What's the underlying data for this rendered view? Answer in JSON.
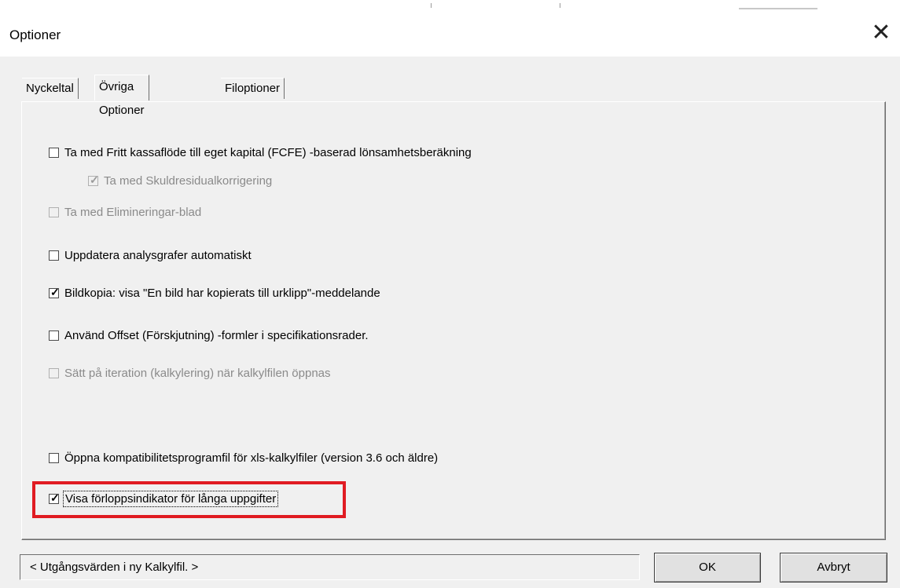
{
  "window": {
    "title": "Optioner",
    "close_icon": "close-icon"
  },
  "tabs": [
    {
      "label": "Nyckeltal",
      "active": false
    },
    {
      "label": "Övriga Optioner",
      "active": true
    },
    {
      "label": "Filoptioner",
      "active": false
    }
  ],
  "options": [
    {
      "label": "Ta med Fritt kassaflöde till eget kapital (FCFE) -baserad lönsamhetsberäkning",
      "checked": false,
      "enabled": true
    },
    {
      "label": "Ta med Skuldresidualkorrigering",
      "checked": true,
      "enabled": false
    },
    {
      "label": "Ta med Elimineringar-blad",
      "checked": false,
      "enabled": false
    },
    {
      "label": "Uppdatera analysgrafer automatiskt",
      "checked": false,
      "enabled": true
    },
    {
      "label": "Bildkopia: visa \"En bild har kopierats till urklipp\"-meddelande",
      "checked": true,
      "enabled": true
    },
    {
      "label": "Använd Offset (Förskjutning) -formler i specifikationsrader.",
      "checked": false,
      "enabled": true
    },
    {
      "label": "Sätt på iteration (kalkylering) när kalkylfilen öppnas",
      "checked": false,
      "enabled": false
    },
    {
      "label": "Öppna kompatibilitetsprogramfil för xls-kalkylfiler (version 3.6 och äldre)",
      "checked": false,
      "enabled": true
    },
    {
      "label": "Visa förloppsindikator för långa uppgifter",
      "checked": true,
      "enabled": true,
      "focused": true
    }
  ],
  "highlight_color": "#e01b22",
  "footer": {
    "defaults_button": "< Utgångsvärden i ny Kalkylfil. >",
    "ok_button": "OK",
    "cancel_button": "Avbryt"
  }
}
